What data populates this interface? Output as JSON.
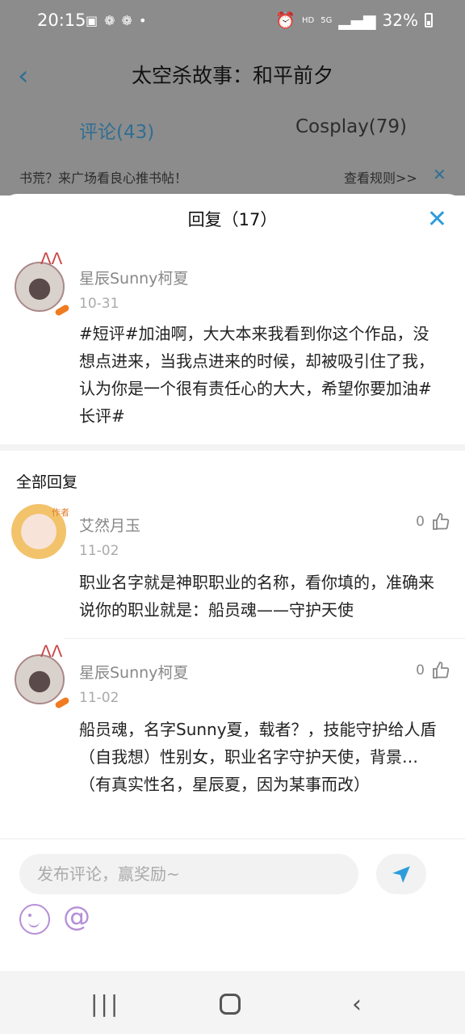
{
  "status_bar": {
    "time": "20:15",
    "left_icons": [
      "image-icon",
      "wechat-icon",
      "wechat-icon",
      "dot-icon"
    ],
    "network": "HD",
    "signal_label": "5G",
    "battery": "32%"
  },
  "header": {
    "title": "太空杀故事：和平前夕",
    "tabs": [
      {
        "label": "评论(43)",
        "active": true
      },
      {
        "label": "Cosplay(79)",
        "active": false
      }
    ],
    "notice": "书荒？来广场看良心推书帖！",
    "rules_link": "查看规则>>"
  },
  "sheet": {
    "title": "回复（17）",
    "original": {
      "user": "星辰Sunny柯夏",
      "date": "10-31",
      "text": "#短评#加油啊，大大本来我看到你这个作品，没想点进来，当我点进来的时候，却被吸引住了我，认为你是一个很有责任心的大大，希望你要加油#长评#"
    },
    "section_title": "全部回复",
    "replies": [
      {
        "user": "艾然月玉",
        "badge": "作者",
        "date": "11-02",
        "likes": "0",
        "text": "职业名字就是神职职业的名称，看你填的，准确来说你的职业就是：船员魂——守护天使"
      },
      {
        "user": "星辰Sunny柯夏",
        "date": "11-02",
        "likes": "0",
        "text": "船员魂，名字Sunny夏，载者？，技能守护给人盾（自我想）性别女，职业名字守护天使，背景…（有真实性名，星辰夏，因为某事而改）"
      }
    ]
  },
  "input": {
    "placeholder": "发布评论，赢奖励~"
  },
  "colors": {
    "accent": "#2d9cdb",
    "dim_overlay": "#8c8c8c",
    "emoji_purple": "#b58fd8"
  }
}
